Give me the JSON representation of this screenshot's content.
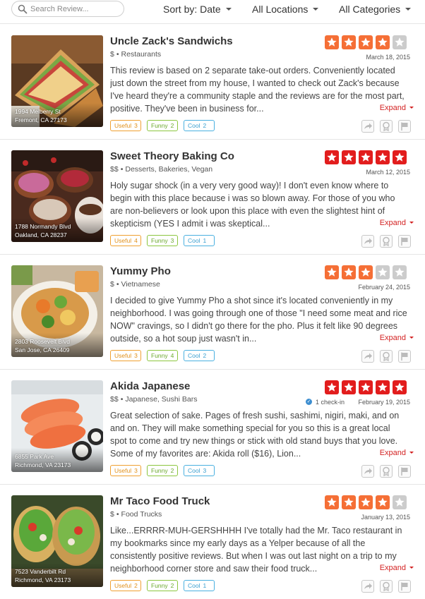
{
  "search": {
    "placeholder": "Search Review..."
  },
  "filters": {
    "sort": "Sort by: Date",
    "locations": "All Locations",
    "categories": "All Categories"
  },
  "colors": {
    "star_orange": "#f56f36",
    "star_red": "#e21d1d",
    "star_gray": "#cccccc",
    "expand_red": "#d32323",
    "useful": "#f0a030",
    "funny": "#8cc63f",
    "cool": "#4ab0e0"
  },
  "expand_label": "Expand",
  "reviews": [
    {
      "name": "Uncle Zack's Sandwichs",
      "price": "$",
      "categories": "Restaurants",
      "rating": 4,
      "star_color": "orange",
      "date": "March 18, 2015",
      "checkin": "",
      "address_line1": "1994 Melberry St",
      "address_line2": "Fremont, CA 27173",
      "text": "This review is based on 2 separate take-out orders. Conveniently located just down the street from my house, I wanted to check out Zack's because I've heard they're a community staple and the reviews are for the most part, positive. They've been in business for...",
      "useful_label": "Useful",
      "useful": "3",
      "funny_label": "Funny",
      "funny": "2",
      "cool_label": "Cool",
      "cool": "2",
      "photo": "sandwich"
    },
    {
      "name": "Sweet Theory Baking Co",
      "price": "$$",
      "categories": "Desserts, Bakeries, Vegan",
      "rating": 5,
      "star_color": "red",
      "date": "March 12, 2015",
      "checkin": "",
      "address_line1": "1788 Normandy Blvd",
      "address_line2": "Oakland, CA 28237",
      "text": "Holy sugar shock (in a very very good way)! I don't even know where to begin with this place because i was so blown away. For those of you who are non-believers or look upon this place with even the slightest hint of skepticism (YES I admit i was skeptical...",
      "useful_label": "Useful",
      "useful": "4",
      "funny_label": "Funny",
      "funny": "3",
      "cool_label": "Cool",
      "cool": "1",
      "photo": "donuts"
    },
    {
      "name": "Yummy Pho",
      "price": "$",
      "categories": "Vietnamese",
      "rating": 3,
      "star_color": "orange",
      "date": "February 24, 2015",
      "checkin": "",
      "address_line1": "2803 Roosevelt Blvd",
      "address_line2": "San Jose, CA 26409",
      "text": "I decided to give Yummy Pho a shot since it's located conveniently in my neighborhood. I was going through one of those \"I need some meat and rice NOW\" cravings, so I didn't go there for the pho. Plus it felt like 90 degrees outside, so a hot soup just wasn't in...",
      "useful_label": "Useful",
      "useful": "3",
      "funny_label": "Funny",
      "funny": "4",
      "cool_label": "Cool",
      "cool": "2",
      "photo": "pho"
    },
    {
      "name": "Akida Japanese",
      "price": "$$",
      "categories": "Japanese, Sushi Bars",
      "rating": 5,
      "star_color": "red",
      "date": "February 19, 2015",
      "checkin": "1 check-in",
      "address_line1": "6855 Park Ave",
      "address_line2": "Richmond, VA 23173",
      "text": "Great selection of sake. Pages of fresh sushi, sashimi, nigiri, maki, and on and on. They will make something special for you so this is a great local spot to come and try new things or stick with old stand buys that you love. Some of my favorites are: Akida roll ($16), Lion...",
      "useful_label": "Useful",
      "useful": "3",
      "funny_label": "Funny",
      "funny": "2",
      "cool_label": "Cool",
      "cool": "3",
      "photo": "sushi"
    },
    {
      "name": "Mr Taco Food Truck",
      "price": "$",
      "categories": "Food Trucks",
      "rating": 4,
      "star_color": "orange",
      "date": "January 13, 2015",
      "checkin": "",
      "address_line1": "7523 Vanderbilt Rd",
      "address_line2": "Richmond, VA 23173",
      "text": "Like...ERRRR-MUH-GERSHHHH I've totally had the Mr. Taco restaurant in my bookmarks since my early days as a Yelper because of all the consistently positive reviews. But when I was out last night on a trip to my neighborhood corner store and saw their food truck...",
      "useful_label": "Useful",
      "useful": "2",
      "funny_label": "Funny",
      "funny": "2",
      "cool_label": "Cool",
      "cool": "1",
      "photo": "tacos"
    }
  ]
}
